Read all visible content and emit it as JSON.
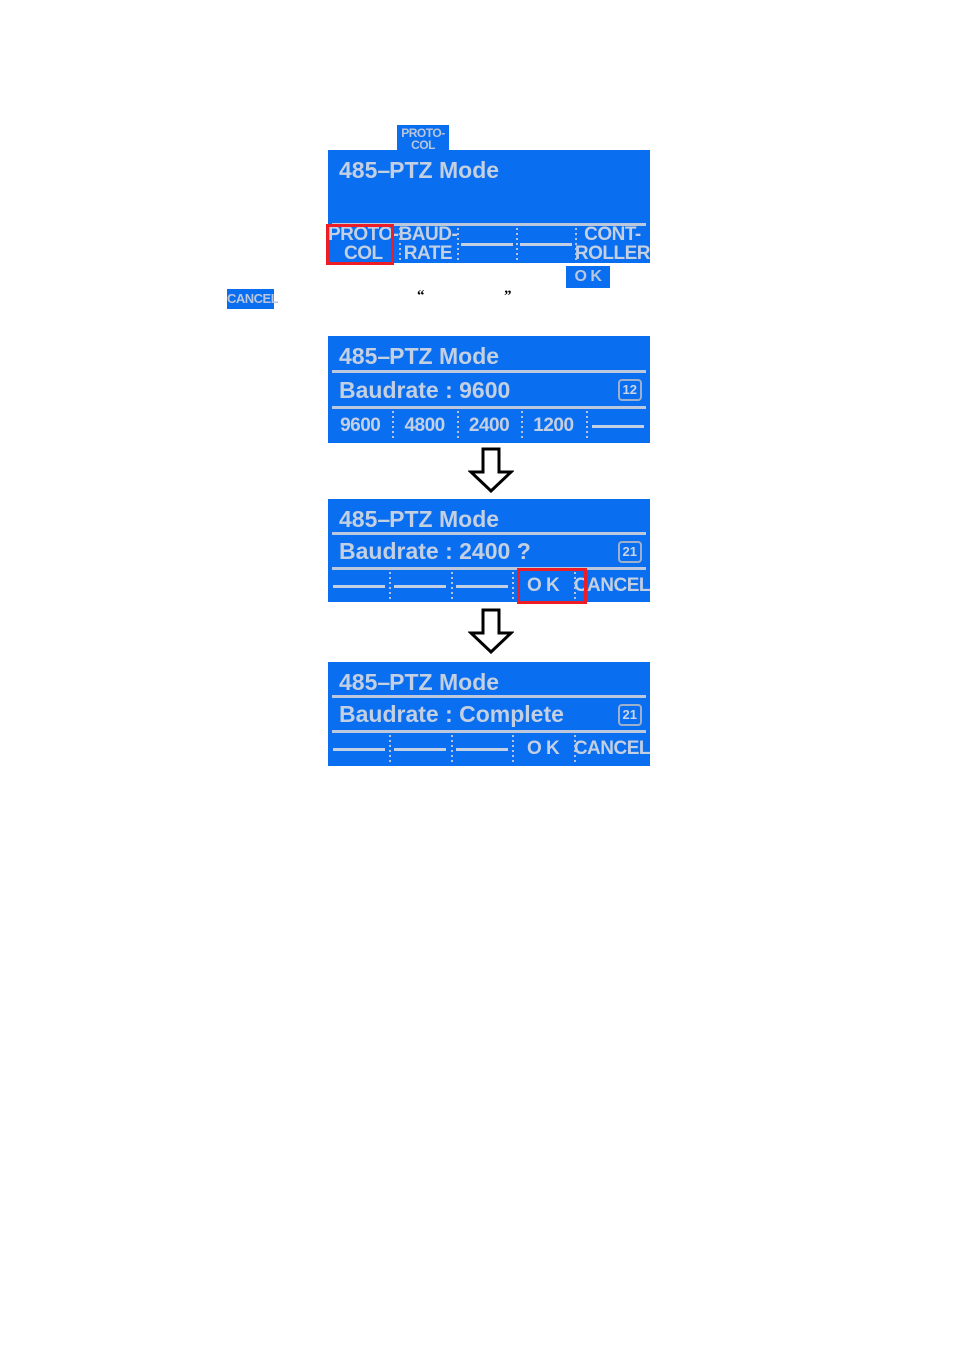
{
  "colors": {
    "lcd_background": "#0a6ef0",
    "lcd_text": "#c3cfe2",
    "selection_outline": "#ee1c25",
    "arrow_outline": "#000000",
    "page_background": "#ffffff"
  },
  "floating": {
    "protocol_badge": "PROTO-\nCOL",
    "protocol_badge_line1": "PROTO-",
    "protocol_badge_line2": "COL",
    "ok_badge": "O K",
    "cancel_badge": "CANCEL",
    "open_quote": "“",
    "close_quote": "”"
  },
  "panels": [
    {
      "id": "ptz-mode-menu",
      "title": "485 - PTZ Mode",
      "title_prefix": "485",
      "title_dash": "–",
      "title_suffix": "PTZ Mode",
      "keys": [
        {
          "label_line1": "PROTO-",
          "label_line2": "COL",
          "type": "text",
          "selected": true
        },
        {
          "label_line1": "BAUD-",
          "label_line2": "RATE",
          "type": "text",
          "selected": false
        },
        {
          "label_line1": "",
          "label_line2": "",
          "type": "blank",
          "selected": false
        },
        {
          "label_line1": "",
          "label_line2": "",
          "type": "blank",
          "selected": false
        },
        {
          "label_line1": "CONT-",
          "label_line2": "ROLLER",
          "type": "text",
          "selected": false
        }
      ]
    },
    {
      "id": "baudrate-select",
      "title": "485 - PTZ Mode",
      "title_prefix": "485",
      "title_dash": "–",
      "title_suffix": "PTZ Mode",
      "value_label": "Baudrate : 9600",
      "step_badge": "12",
      "keys": [
        {
          "label_line1": "9600",
          "label_line2": "",
          "type": "text",
          "selected": false
        },
        {
          "label_line1": "4800",
          "label_line2": "",
          "type": "text",
          "selected": false
        },
        {
          "label_line1": "2400",
          "label_line2": "",
          "type": "text",
          "selected": false
        },
        {
          "label_line1": "1200",
          "label_line2": "",
          "type": "text",
          "selected": false
        },
        {
          "label_line1": "",
          "label_line2": "",
          "type": "blank",
          "selected": false
        }
      ]
    },
    {
      "id": "baudrate-confirm",
      "title": "485 - PTZ Mode",
      "title_prefix": "485",
      "title_dash": "–",
      "title_suffix": "PTZ Mode",
      "value_label": "Baudrate : 2400 ?",
      "step_badge": "21",
      "keys": [
        {
          "label_line1": "",
          "label_line2": "",
          "type": "blank",
          "selected": false
        },
        {
          "label_line1": "",
          "label_line2": "",
          "type": "blank",
          "selected": false
        },
        {
          "label_line1": "",
          "label_line2": "",
          "type": "blank",
          "selected": false
        },
        {
          "label_line1": "O K",
          "label_line2": "",
          "type": "text",
          "selected": true
        },
        {
          "label_line1": "CANCEL",
          "label_line2": "",
          "type": "text",
          "selected": false
        }
      ]
    },
    {
      "id": "baudrate-complete",
      "title": "485 - PTZ Mode",
      "title_prefix": "485",
      "title_dash": "–",
      "title_suffix": "PTZ Mode",
      "value_label": "Baudrate : Complete",
      "step_badge": "21",
      "keys": [
        {
          "label_line1": "",
          "label_line2": "",
          "type": "blank",
          "selected": false
        },
        {
          "label_line1": "",
          "label_line2": "",
          "type": "blank",
          "selected": false
        },
        {
          "label_line1": "",
          "label_line2": "",
          "type": "blank",
          "selected": false
        },
        {
          "label_line1": "O K",
          "label_line2": "",
          "type": "text",
          "selected": false
        },
        {
          "label_line1": "CANCEL",
          "label_line2": "",
          "type": "text",
          "selected": false
        }
      ]
    }
  ],
  "arrows": [
    {
      "name": "flow-arrow-1",
      "direction": "down"
    },
    {
      "name": "flow-arrow-2",
      "direction": "down"
    }
  ]
}
